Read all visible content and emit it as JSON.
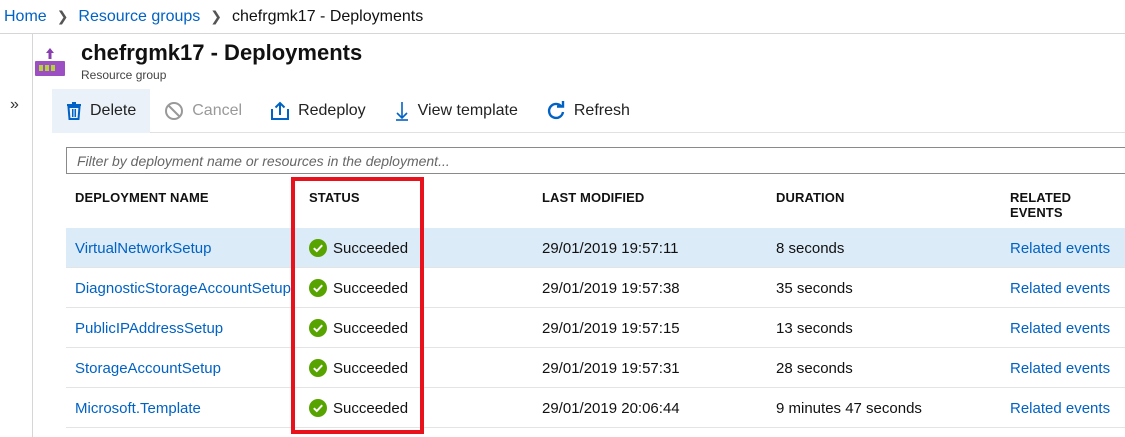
{
  "breadcrumb": {
    "home": "Home",
    "resource_groups": "Resource groups",
    "current": "chefrgmk17 - Deployments"
  },
  "header": {
    "title": "chefrgmk17 - Deployments",
    "subtitle": "Resource group"
  },
  "toolbar": {
    "delete": "Delete",
    "cancel": "Cancel",
    "redeploy": "Redeploy",
    "view_template": "View template",
    "refresh": "Refresh"
  },
  "filter": {
    "placeholder": "Filter by deployment name or resources in the deployment..."
  },
  "table": {
    "headers": {
      "name": "DEPLOYMENT NAME",
      "status": "STATUS",
      "modified": "LAST MODIFIED",
      "duration": "DURATION",
      "events": "RELATED EVENTS"
    },
    "rows": [
      {
        "name": "VirtualNetworkSetup",
        "status": "Succeeded",
        "modified": "29/01/2019 19:57:11",
        "duration": "8 seconds",
        "events": "Related events"
      },
      {
        "name": "DiagnosticStorageAccountSetup",
        "status": "Succeeded",
        "modified": "29/01/2019 19:57:38",
        "duration": "35 seconds",
        "events": "Related events"
      },
      {
        "name": "PublicIPAddressSetup",
        "status": "Succeeded",
        "modified": "29/01/2019 19:57:15",
        "duration": "13 seconds",
        "events": "Related events"
      },
      {
        "name": "StorageAccountSetup",
        "status": "Succeeded",
        "modified": "29/01/2019 19:57:31",
        "duration": "28 seconds",
        "events": "Related events"
      },
      {
        "name": "Microsoft.Template",
        "status": "Succeeded",
        "modified": "29/01/2019 20:06:44",
        "duration": "9 minutes 47 seconds",
        "events": "Related events"
      }
    ]
  },
  "colors": {
    "link": "#0062c4",
    "success": "#57a300",
    "highlight": "#e8121c",
    "selected_row": "#dcebf8"
  }
}
